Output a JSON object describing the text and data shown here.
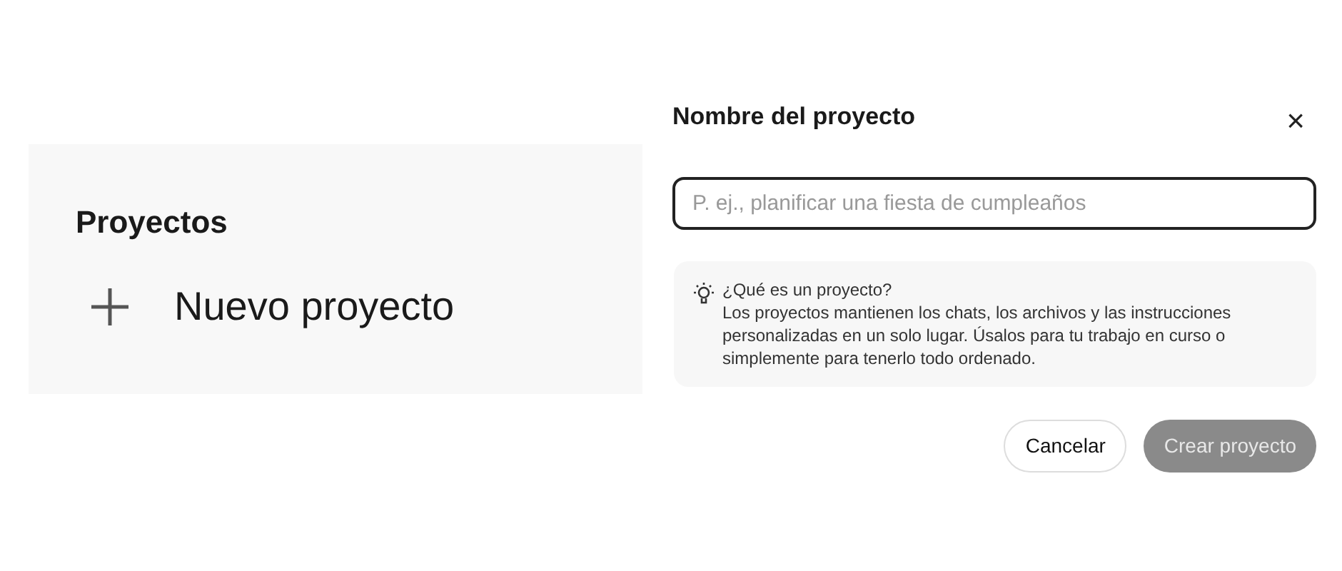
{
  "sidebar": {
    "heading": "Proyectos",
    "new_project": "Nuevo proyecto"
  },
  "dialog": {
    "title": "Nombre del proyecto",
    "close": "×",
    "name_field": {
      "placeholder": "P. ej., planificar una fiesta de cumpleaños"
    },
    "info": {
      "title": "¿Qué es un proyecto?",
      "body": "Los proyectos mantienen los chats, los archivos y las instrucciones personalizadas en un solo lugar. Úsalos para tu trabajo en curso o simplemente para tenerlo todo ordenado."
    },
    "buttons": [
      {
        "label": "Cancelar",
        "kind": "secondary",
        "disabled": false
      },
      {
        "label": "Crear proyecto",
        "kind": "primary",
        "disabled": true
      }
    ]
  }
}
